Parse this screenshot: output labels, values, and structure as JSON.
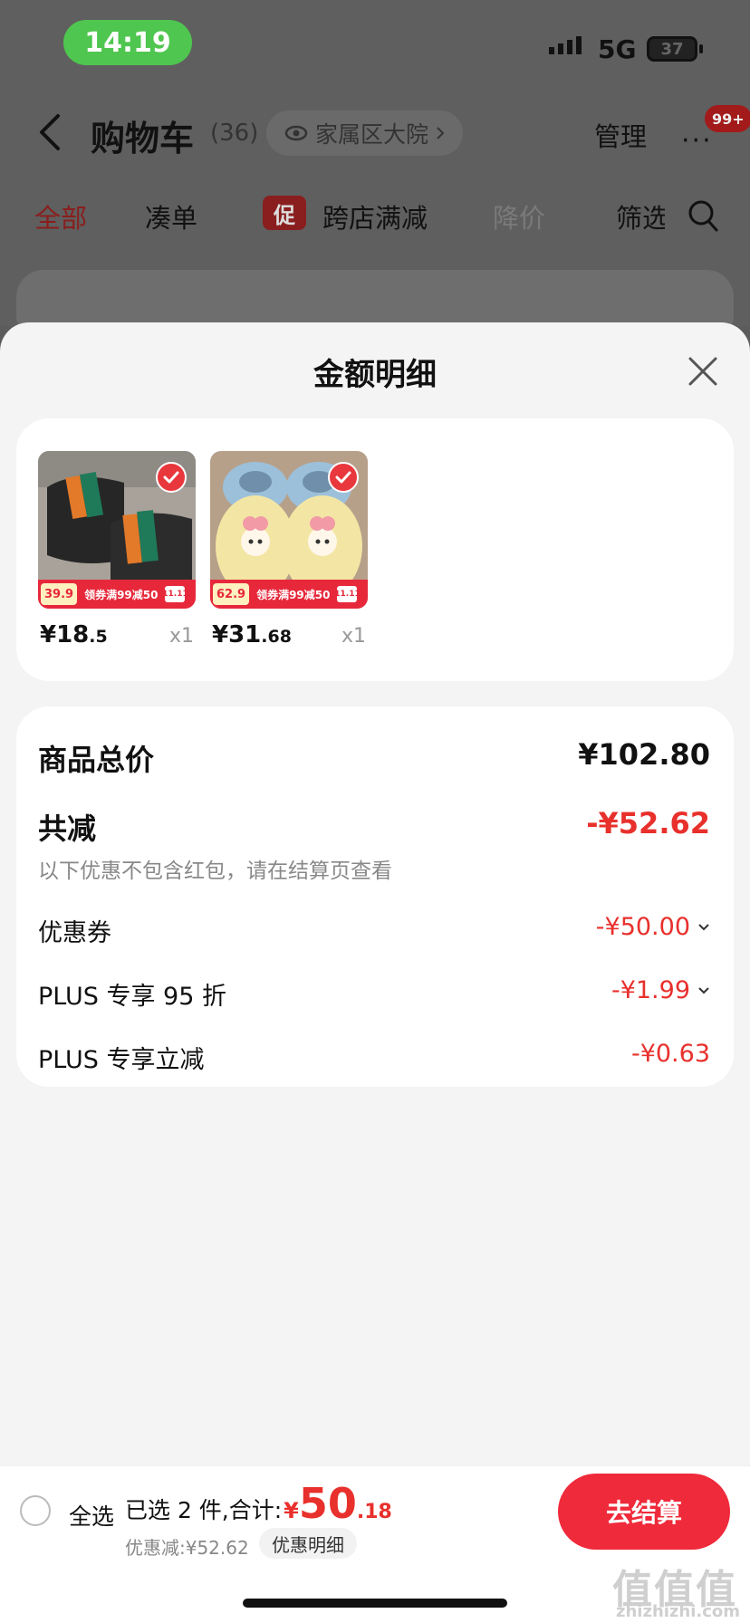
{
  "status_bar": {
    "time": "14:19",
    "network": "5G",
    "battery": "37"
  },
  "header": {
    "title": "购物车",
    "count": "(36)",
    "address": "家属区大院",
    "manage_label": "管理",
    "more_label": "···",
    "badge": "99+"
  },
  "tabs": [
    {
      "label": "全部"
    },
    {
      "label": "凑单"
    },
    {
      "label": "跨店满减",
      "badge": "促"
    },
    {
      "label": "降价"
    },
    {
      "label": "筛选"
    }
  ],
  "sheet": {
    "title": "金额明细",
    "items": [
      {
        "price_int": "¥18",
        "price_dec": ".5",
        "qty": "x1",
        "promo_price": "39.9",
        "promo_text": "领券满99减50",
        "promo_tail": "11.11",
        "checked": true
      },
      {
        "price_int": "¥31",
        "price_dec": ".68",
        "qty": "x1",
        "promo_price": "62.9",
        "promo_text": "领券满99减50",
        "promo_tail": "11.11",
        "checked": true
      }
    ],
    "summary": {
      "total_label": "商品总价",
      "total_value": "¥102.80",
      "reduce_label": "共减",
      "reduce_value": "-¥52.62",
      "note": "以下优惠不包含红包，请在结算页查看",
      "lines": [
        {
          "label": "优惠券",
          "value": "-¥50.00",
          "expandable": true
        },
        {
          "label": "PLUS 专享 95 折",
          "value": "-¥1.99",
          "expandable": true
        },
        {
          "label": "PLUS 专享立减",
          "value": "-¥0.63",
          "expandable": false
        }
      ]
    }
  },
  "bottom_bar": {
    "select_all": "全选",
    "selected_label": "已选 2 件,合计:",
    "currency": "¥",
    "amount_int": "50",
    "amount_dec": ".18",
    "discount": "优惠减:¥52.62",
    "detail_button": "优惠明细",
    "checkout_button": "去结算"
  },
  "watermark": {
    "text": "值值值",
    "sub": "zhizhizhi.com"
  }
}
